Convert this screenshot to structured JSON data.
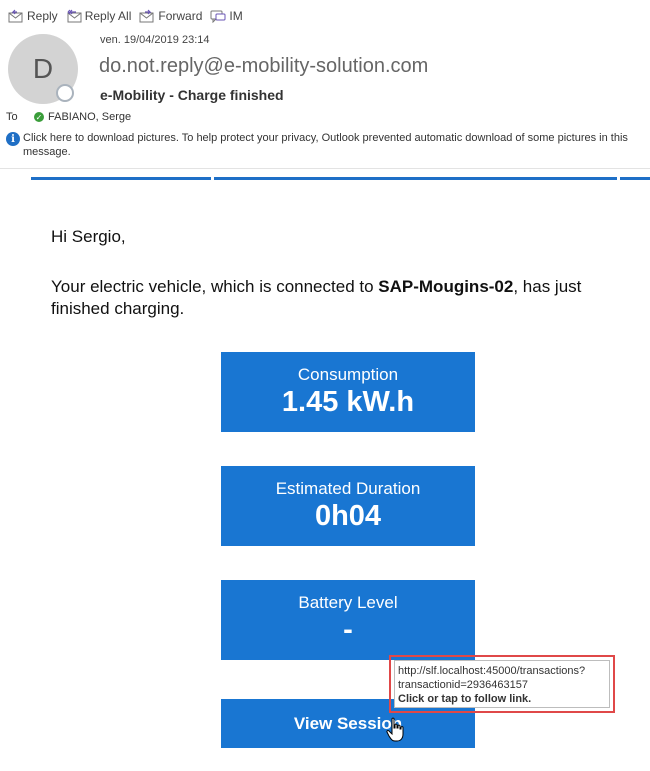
{
  "toolbar": {
    "reply": "Reply",
    "reply_all": "Reply All",
    "forward": "Forward",
    "im": "IM"
  },
  "header": {
    "avatar_initial": "D",
    "date": "ven. 19/04/2019 23:14",
    "from": "do.not.reply@e-mobility-solution.com",
    "subject": "e-Mobility - Charge finished",
    "to_label": "To",
    "to_name": "FABIANO, Serge",
    "info_bar": "Click here to download pictures. To help protect your privacy, Outlook prevented automatic download of some pictures in this message."
  },
  "body": {
    "greeting": "Hi Sergio,",
    "message_pre": "Your electric vehicle, which is connected to ",
    "station": "SAP-Mougins-02",
    "message_post": ", has just finished charging."
  },
  "tiles": [
    {
      "label": "Consumption",
      "value": "1.45 kW.h"
    },
    {
      "label": "Estimated Duration",
      "value": "0h04"
    },
    {
      "label": "Battery Level",
      "value": "-"
    }
  ],
  "button": {
    "label": "View Session"
  },
  "tooltip": {
    "url_line1": "http://slf.localhost:45000/transactions?",
    "url_line2": "transactionid=2936463157",
    "hint": "Click or tap to follow link."
  },
  "colors": {
    "accent": "#1976d2",
    "highlight": "#e04848"
  }
}
